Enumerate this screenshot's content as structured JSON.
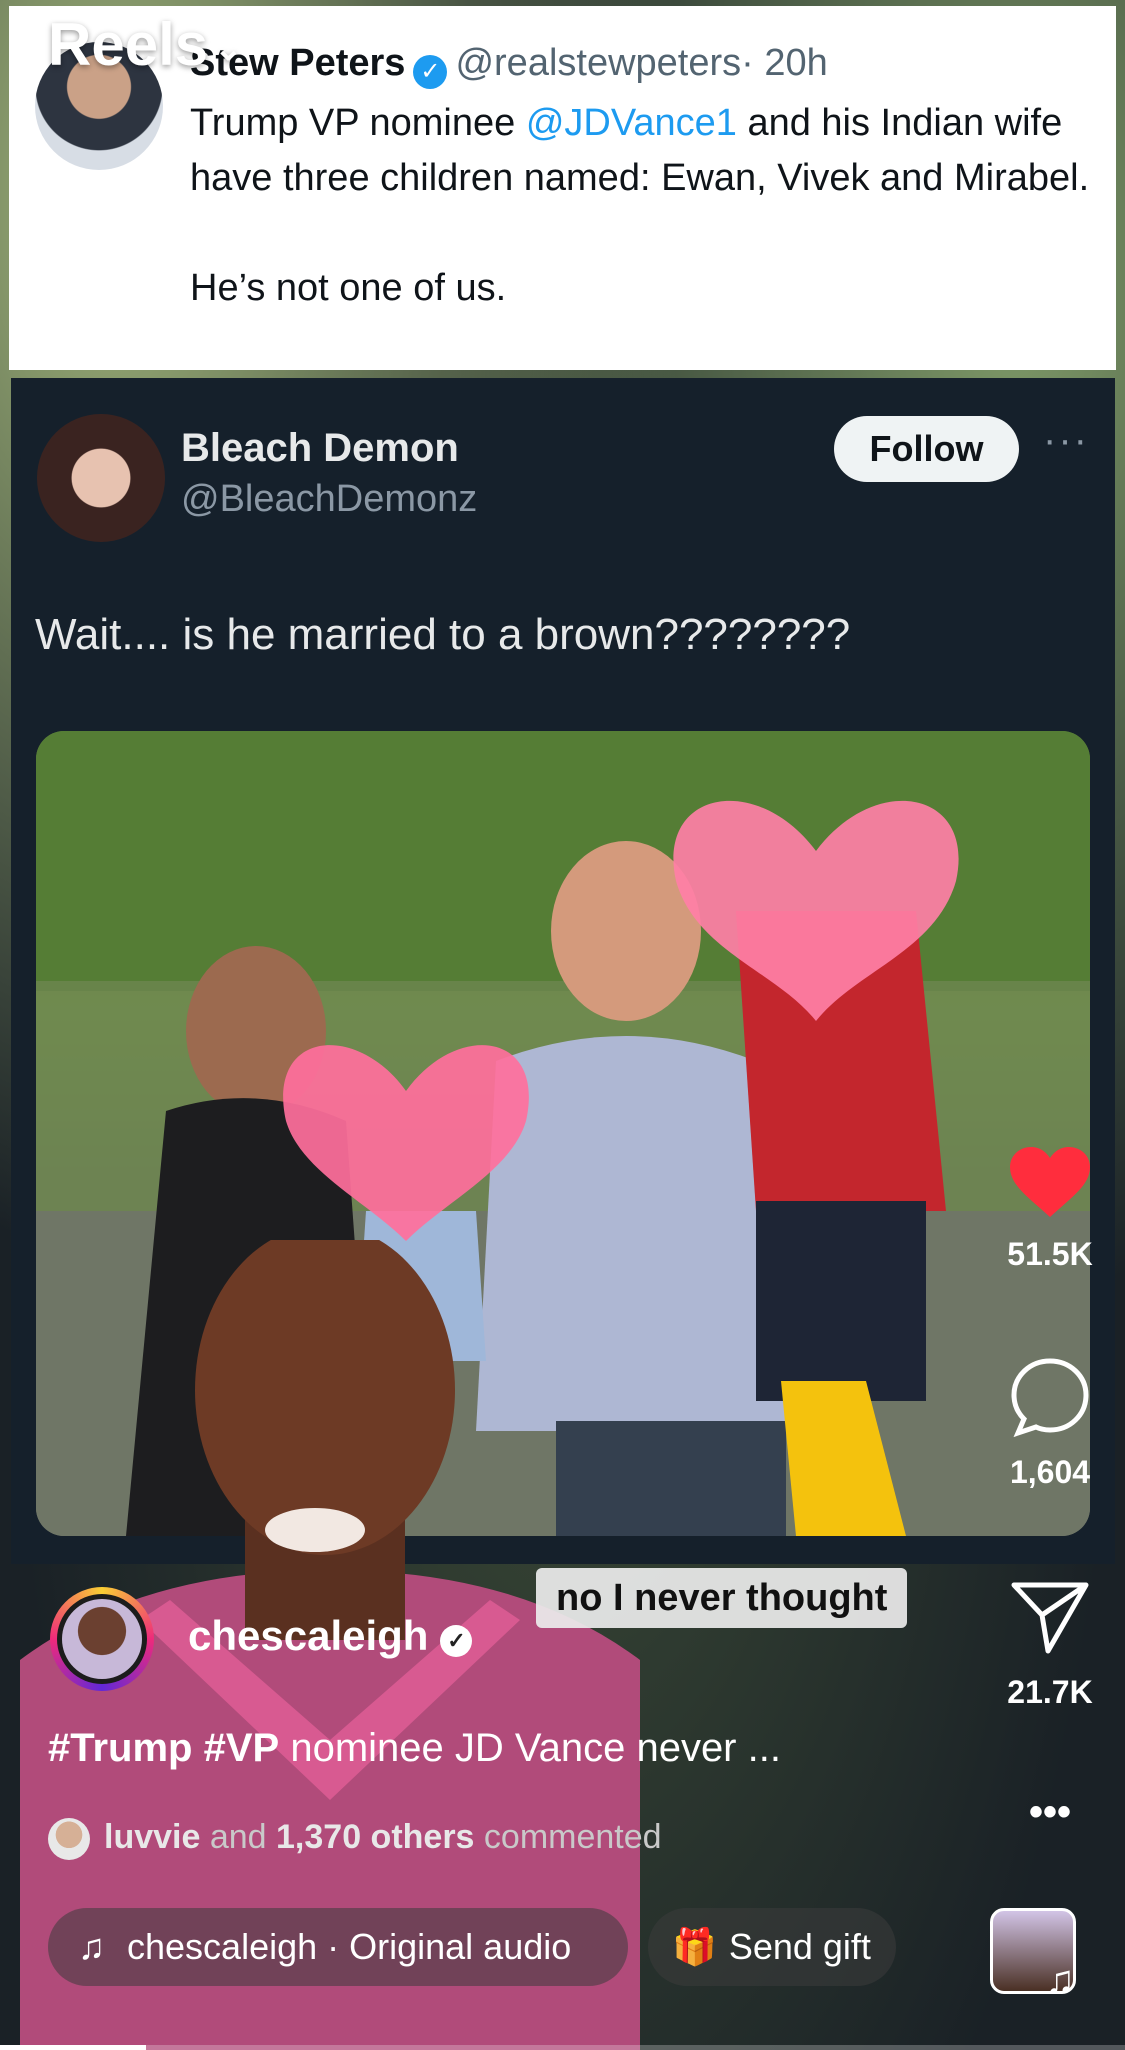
{
  "header": {
    "title": "Reels"
  },
  "tweet1": {
    "name": "Stew Peters",
    "handle": "@realstewpeters",
    "time": "· 20h",
    "text_pre": "Trump VP nominee ",
    "mention": "@JDVance1",
    "text_post": " and his Indian wife have three children named: Ewan, Vivek and Mirabel.",
    "text2": "He’s not one of us."
  },
  "tweet2": {
    "name": "Bleach Demon",
    "handle": "@BleachDemonz",
    "follow_label": "Follow",
    "more": "···",
    "text": "Wait.... is he married to a brown????????"
  },
  "reel": {
    "caption_overlay": "no I never thought",
    "username": "chescaleigh",
    "caption_tag1": "#Trump",
    "caption_tag2": "#VP",
    "caption_rest": " nominee JD Vance never ...",
    "comments_user": "luvvie",
    "comments_mid": " and ",
    "comments_count": "1,370 others",
    "comments_end": " commented",
    "audio": "chescaleigh · Original audio",
    "gift": "Send gift",
    "more": "•••"
  },
  "actions": {
    "likes": "51.5K",
    "comments": "1,604",
    "shares": "21.7K"
  },
  "colors": {
    "accent_blue": "#1d9bf0",
    "like_red": "#ff2d3d"
  },
  "progress": 0.13
}
